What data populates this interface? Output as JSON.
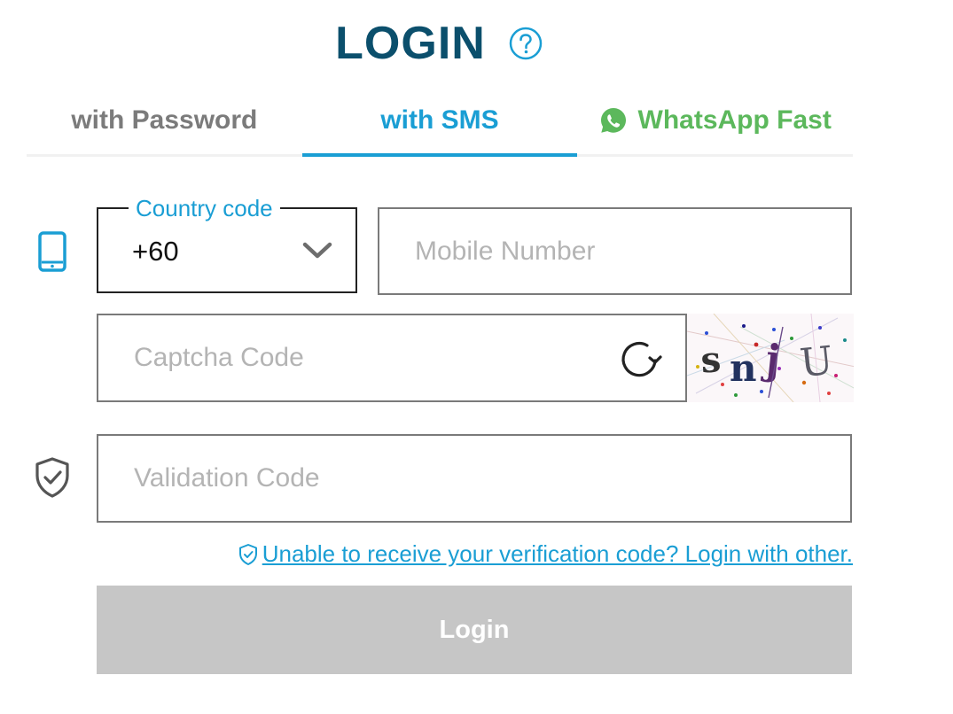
{
  "header": {
    "title": "LOGIN",
    "help_icon": "question-circle-icon"
  },
  "tabs": [
    {
      "label": "with Password",
      "active": false
    },
    {
      "label": "with SMS",
      "active": true
    },
    {
      "label": "WhatsApp Fast",
      "active": false,
      "icon": "whatsapp-icon"
    }
  ],
  "form": {
    "phone_icon": "mobile-phone-icon",
    "country_code": {
      "label": "Country code",
      "value": "+60",
      "icon": "chevron-down-icon"
    },
    "mobile": {
      "placeholder": "Mobile Number",
      "value": ""
    },
    "captcha": {
      "placeholder": "Captcha Code",
      "value": "",
      "refresh_icon": "refresh-icon",
      "image_text": "snjU"
    },
    "validation": {
      "icon": "shield-check-icon",
      "placeholder": "Validation Code",
      "value": ""
    },
    "help_link": "Unable to receive your verification code? Login with other.",
    "submit_label": "Login"
  },
  "colors": {
    "title": "#0b4f6c",
    "accent": "#1a9ed4",
    "whatsapp": "#5cb85c",
    "tab_inactive": "#7b7b7b",
    "button_disabled": "#c6c6c6"
  }
}
